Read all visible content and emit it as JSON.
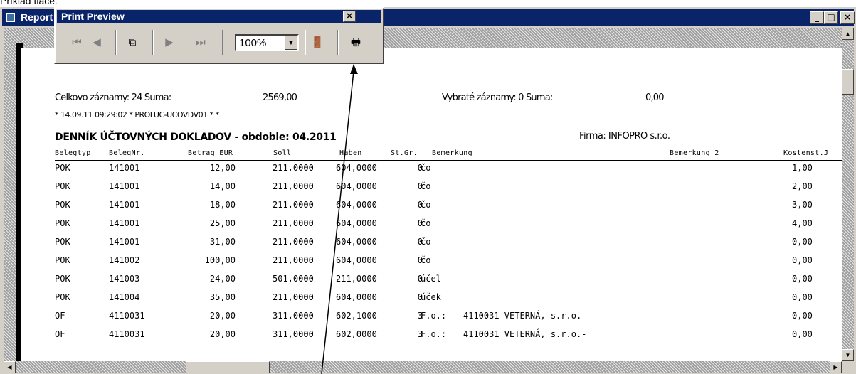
{
  "caption": "Príklad tlače:",
  "window": {
    "title": "Report"
  },
  "preview": {
    "title": "Print Preview",
    "zoom": "100%",
    "icons": [
      "first-page-icon",
      "previous-page-icon",
      "multiple-pages-icon",
      "next-page-icon",
      "last-page-icon",
      "exit-door-icon",
      "printer-icon"
    ]
  },
  "report": {
    "summary_left": "Celkovo záznamy:   24   Suma:",
    "summary_left_value": "2569,00",
    "summary_right": "Vybraté záznamy:   0   Suma:",
    "summary_right_value": "0,00",
    "stamp": "* 14.09.11 09:29:02 * PROLUC-UCOVDV01 *  *",
    "heading": "DENNÍK ÚČTOVNÝCH DOKLADOV - obdobie: 04.2011",
    "firma": "Firma:  INFOPRO s.r.o.",
    "columns": [
      "Belegtyp",
      "BelegNr.",
      "Betrag EUR",
      "Soll",
      "Haben",
      "St.Gr.",
      "Bemerkung",
      "Bemerkung 2",
      "Kostenst.J"
    ],
    "rows": [
      [
        "POK",
        "141001",
        "12,00",
        "211,0000",
        "604,0000",
        "0",
        "čo",
        "",
        "1,00"
      ],
      [
        "POK",
        "141001",
        "14,00",
        "211,0000",
        "604,0000",
        "0",
        "čo",
        "",
        "2,00"
      ],
      [
        "POK",
        "141001",
        "18,00",
        "211,0000",
        "604,0000",
        "0",
        "čo",
        "",
        "3,00"
      ],
      [
        "POK",
        "141001",
        "25,00",
        "211,0000",
        "604,0000",
        "0",
        "čo",
        "",
        "4,00"
      ],
      [
        "POK",
        "141001",
        "31,00",
        "211,0000",
        "604,0000",
        "0",
        "čo",
        "",
        "0,00"
      ],
      [
        "POK",
        "141002",
        "100,00",
        "211,0000",
        "604,0000",
        "0",
        "čo",
        "",
        "0,00"
      ],
      [
        "POK",
        "141003",
        "24,00",
        "501,0000",
        "211,0000",
        "0",
        "účel",
        "",
        "0,00"
      ],
      [
        "POK",
        "141004",
        "35,00",
        "211,0000",
        "604,0000",
        "0",
        "úček",
        "",
        "0,00"
      ],
      [
        "OF",
        "4110031",
        "20,00",
        "311,0000",
        "602,1000",
        "3",
        "F.o.:",
        "4110031 VETERNÁ, s.r.o.-",
        "0,00"
      ],
      [
        "OF",
        "4110031",
        "20,00",
        "311,0000",
        "602,0000",
        "3",
        "F.o.:",
        "4110031 VETERNÁ, s.r.o.-",
        "0,00"
      ]
    ]
  }
}
